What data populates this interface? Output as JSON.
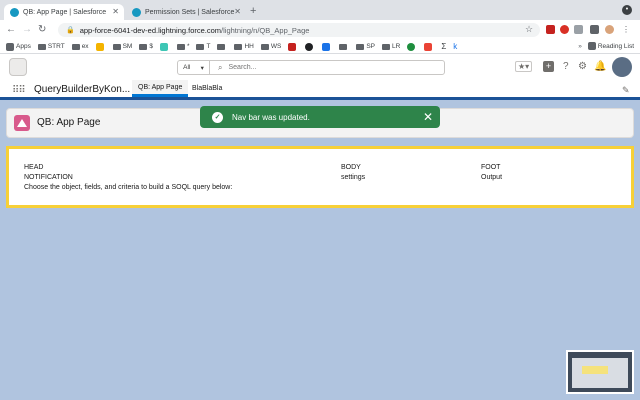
{
  "browser": {
    "tabs": [
      {
        "title": "QB: App Page | Salesforce",
        "active": true
      },
      {
        "title": "Permission Sets | Salesforce",
        "active": false
      }
    ],
    "url_host": "app-force-6041-dev-ed.lightning.force.com",
    "url_path": "/lightning/n/QB_App_Page",
    "bookmarks": [
      "Apps",
      "STRT",
      "ex",
      "SM",
      "$",
      "*",
      "T",
      "HH",
      "WS",
      "SP",
      "LR"
    ],
    "reading_list": "Reading List"
  },
  "salesforce": {
    "search_scope": "All",
    "search_placeholder": "Search...",
    "app_name": "QueryBuilderByKon...",
    "nav_tabs": [
      "QB: App Page",
      "BlaBlaBla"
    ],
    "page_title": "QB: App Page",
    "toast_message": "Nav bar was updated.",
    "body": {
      "col1": [
        "HEAD",
        "NOTIFICATION",
        "Choose the object, fields, and criteria to build a SOQL query below:"
      ],
      "col2": [
        "BODY",
        "settings"
      ],
      "col3": [
        "FOOT",
        "Output"
      ]
    }
  },
  "colors": {
    "toast": "#2e844a",
    "brand_blue": "#0176d3",
    "card_border": "#f7d038",
    "page_icon": "#d85a8c"
  }
}
